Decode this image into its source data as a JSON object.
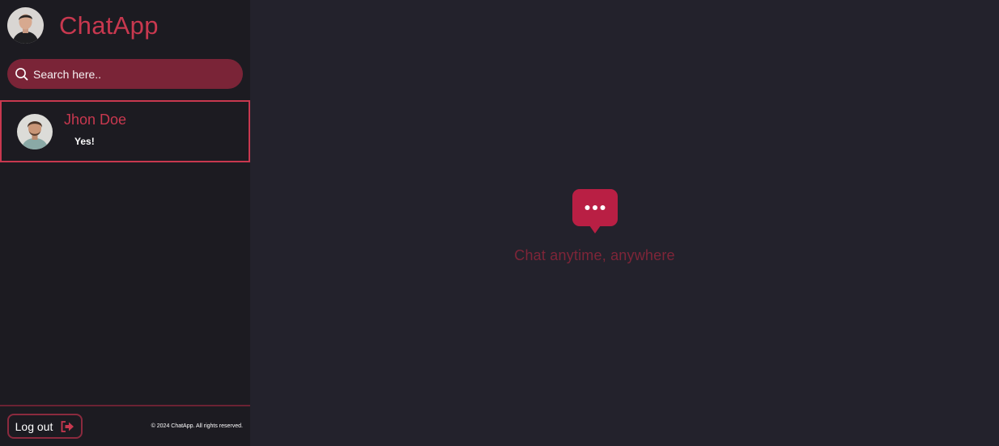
{
  "app": {
    "title": "ChatApp"
  },
  "colors": {
    "accent": "#c8384f",
    "search_bg": "#7a2437",
    "sidebar_bg": "#1c1b21",
    "main_bg": "#23222c",
    "muted_accent": "#7e2538"
  },
  "user": {
    "avatar_icon": "user-avatar-icon"
  },
  "search": {
    "placeholder": "Search here.."
  },
  "contacts": [
    {
      "name": "Jhon Doe",
      "last_message": "Yes!",
      "avatar_icon": "contact-avatar-icon"
    }
  ],
  "footer": {
    "logout_label": "Log out",
    "logout_icon": "logout-arrow-icon",
    "copyright": "© 2024 ChatApp. All rights reserved."
  },
  "main": {
    "empty_icon": "chat-bubble-icon",
    "empty_text": "Chat anytime, anywhere"
  }
}
